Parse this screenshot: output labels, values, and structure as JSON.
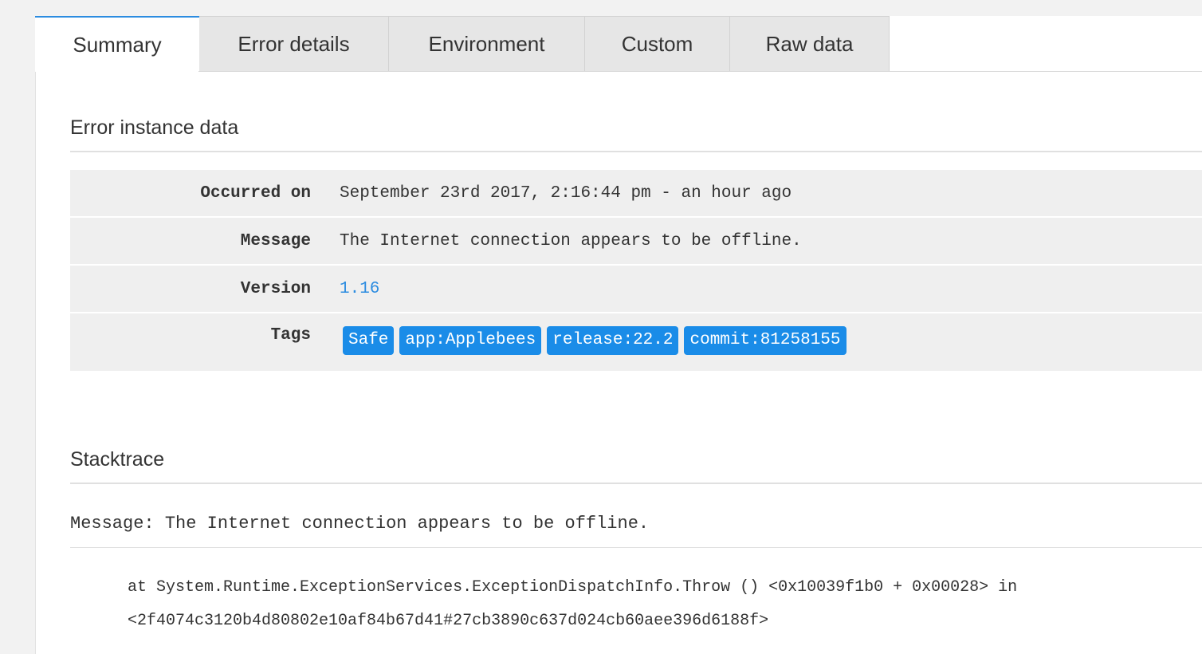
{
  "tabs": [
    {
      "label": "Summary",
      "active": true
    },
    {
      "label": "Error details",
      "active": false
    },
    {
      "label": "Environment",
      "active": false
    },
    {
      "label": "Custom",
      "active": false
    },
    {
      "label": "Raw data",
      "active": false
    }
  ],
  "instance": {
    "title": "Error instance data",
    "occurred_label": "Occurred on",
    "occurred_value": "September 23rd 2017, 2:16:44 pm - an hour ago",
    "message_label": "Message",
    "message_value": "The Internet connection appears to be offline.",
    "version_label": "Version",
    "version_value": "1.16",
    "tags_label": "Tags",
    "tags": [
      "Safe",
      "app:Applebees",
      "release:22.2",
      "commit:81258155"
    ]
  },
  "stacktrace": {
    "title": "Stacktrace",
    "message": "Message: The Internet connection appears to be offline.",
    "lines": [
      "at System.Runtime.ExceptionServices.ExceptionDispatchInfo.Throw () <0x10039f1b0 + 0x00028> in",
      "<2f4074c3120b4d80802e10af84b67d41#27cb3890c637d024cb60aee396d6188f>"
    ]
  },
  "colors": {
    "accent": "#2c8ce0",
    "tag_bg": "#1a8ce8",
    "row_bg": "#efefef",
    "tab_inactive_bg": "#e6e6e6"
  }
}
